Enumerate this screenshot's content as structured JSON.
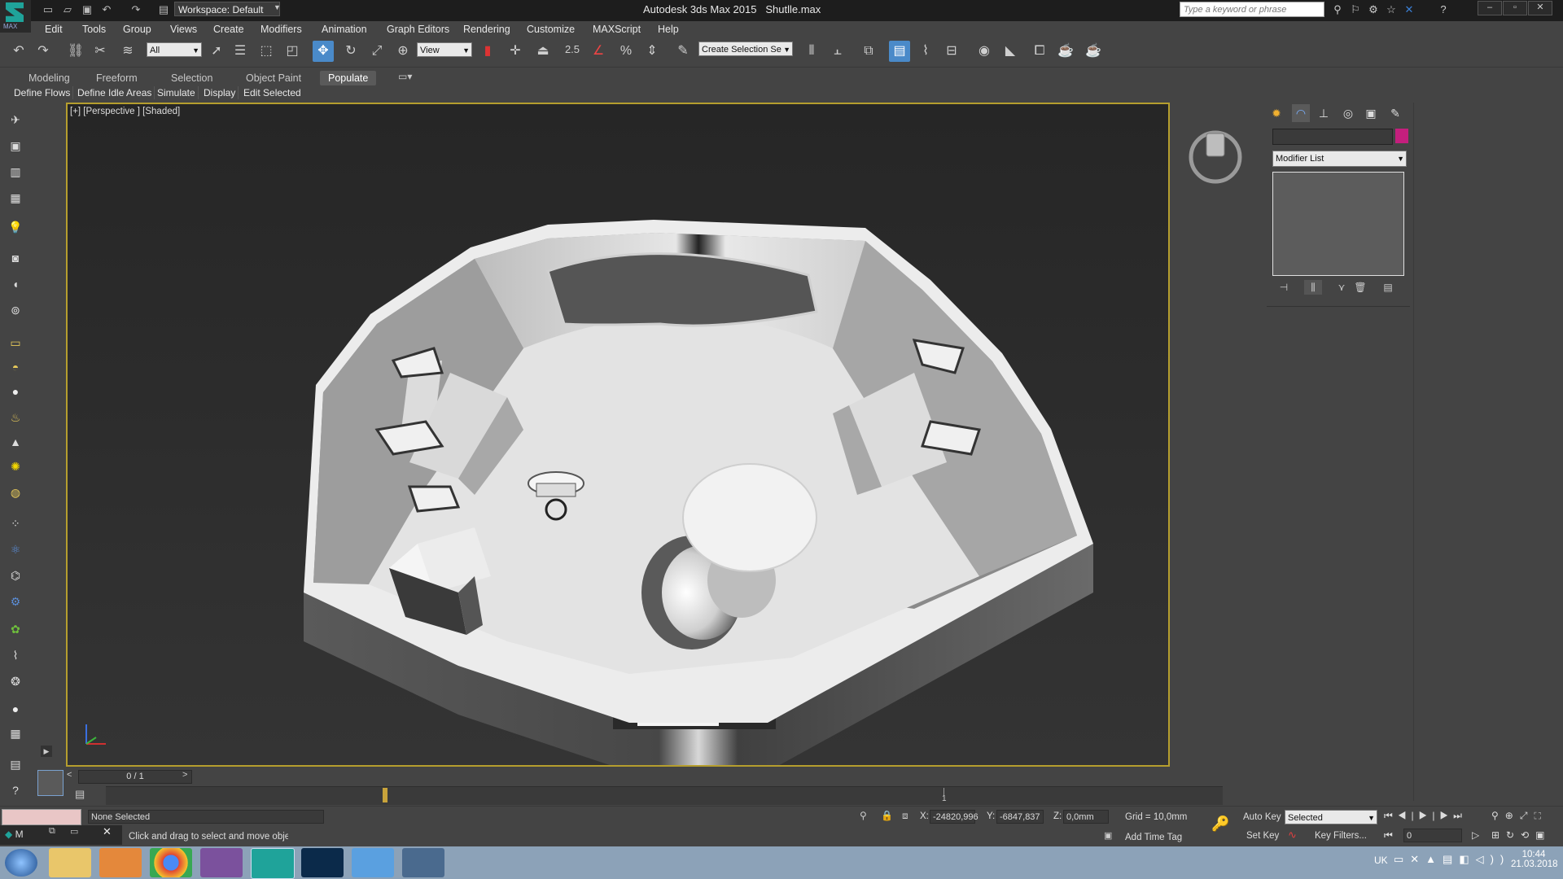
{
  "titlebar": {
    "workspace_label": "Workspace: Default",
    "app_title": "Autodesk 3ds Max  2015",
    "file_name": "Shutlle.max",
    "search_placeholder": "Type a keyword or phrase",
    "logo_text": "MAX"
  },
  "menu": [
    "Edit",
    "Tools",
    "Group",
    "Views",
    "Create",
    "Modifiers",
    "Animation",
    "Graph Editors",
    "Rendering",
    "Customize",
    "MAXScript",
    "Help"
  ],
  "toolbar": {
    "selection_filter": "All",
    "ref_coord": "View",
    "snap_value": "2.5",
    "named_selection": "Create Selection Se"
  },
  "ribbon": {
    "tabs": [
      "Modeling",
      "Freeform",
      "Selection",
      "Object Paint",
      "Populate"
    ],
    "active_tab": "Populate",
    "buttons": [
      "Define Flows",
      "Define Idle Areas",
      "Simulate",
      "Display",
      "Edit Selected"
    ]
  },
  "viewport": {
    "label": "[+] [Perspective ] [Shaded]"
  },
  "command_panel": {
    "modifier_list": "Modifier List",
    "object_color": "#c41f7d"
  },
  "timeline": {
    "frame": "0 / 1",
    "prev": "<",
    "next": ">",
    "tick_label": "1"
  },
  "status": {
    "selection": "None Selected",
    "prompt": "Click and drag to select and move objects",
    "x_label": "X:",
    "x_value": "-24820,996",
    "y_label": "Y:",
    "y_value": "-6847,837",
    "z_label": "Z:",
    "z_value": "0,0mm",
    "grid": "Grid = 10,0mm",
    "add_time_tag": "Add Time Tag",
    "auto_key": "Auto Key",
    "set_key": "Set Key",
    "key_mode": "Selected",
    "key_filters": "Key Filters...",
    "current_frame": "0",
    "maxscript_item": "M"
  },
  "taskbar": {
    "language": "UK",
    "time": "10:44",
    "date": "21.03.2018"
  }
}
